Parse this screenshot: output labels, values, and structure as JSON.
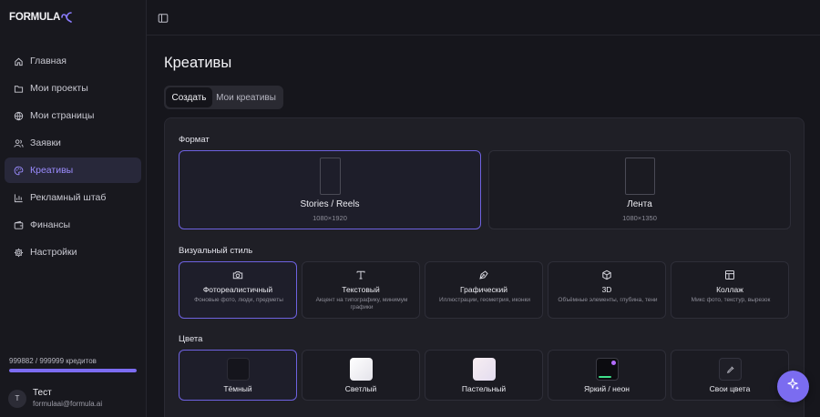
{
  "brand": {
    "name": "FORMULA",
    "accent": "#7c6cf2"
  },
  "sidebar": {
    "items": [
      {
        "label": "Главная",
        "icon": "home-icon"
      },
      {
        "label": "Мои проекты",
        "icon": "folder-icon"
      },
      {
        "label": "Мои страницы",
        "icon": "globe-icon"
      },
      {
        "label": "Заявки",
        "icon": "users-icon"
      },
      {
        "label": "Креативы",
        "icon": "palette-icon",
        "active": true
      },
      {
        "label": "Рекламный штаб",
        "icon": "bar-chart-icon"
      },
      {
        "label": "Финансы",
        "icon": "wallet-icon"
      },
      {
        "label": "Настройки",
        "icon": "gear-icon"
      }
    ],
    "credits_text": "999882 / 999999 кредитов",
    "credits_fraction": 0.9999,
    "user": {
      "initial": "Т",
      "name": "Тест",
      "email": "formulaai@formula.ai"
    }
  },
  "header": {
    "toggle_icon": "sidebar-toggle-icon"
  },
  "page": {
    "title": "Креативы",
    "tabs": [
      {
        "label": "Создать",
        "active": true
      },
      {
        "label": "Мои креативы",
        "active": false
      }
    ]
  },
  "format": {
    "label": "Формат",
    "options": [
      {
        "title": "Stories / Reels",
        "size": "1080×1920",
        "selected": true
      },
      {
        "title": "Лента",
        "size": "1080×1350",
        "selected": false
      }
    ]
  },
  "style": {
    "label": "Визуальный стиль",
    "options": [
      {
        "title": "Фотореалистичный",
        "desc": "Фоновые фото, люди, предметы",
        "icon": "camera-icon",
        "selected": true
      },
      {
        "title": "Текстовый",
        "desc": "Акцент на типографику, минимум графики",
        "icon": "text-icon"
      },
      {
        "title": "Графический",
        "desc": "Иллюстрации, геометрия, иконки",
        "icon": "pen-tool-icon"
      },
      {
        "title": "3D",
        "desc": "Объёмные элементы, глубина, тени",
        "icon": "cube-icon"
      },
      {
        "title": "Коллаж",
        "desc": "Микс фото, текстур, вырезок",
        "icon": "layout-icon"
      }
    ]
  },
  "colors": {
    "label": "Цвета",
    "options": [
      {
        "title": "Тёмный",
        "swatch": "#15151c",
        "selected": true
      },
      {
        "title": "Светлый",
        "swatch": "#f1f0f4"
      },
      {
        "title": "Пастельный",
        "swatch": "#ece4ee"
      },
      {
        "title": "Яркий / неон",
        "swatch": "#0c0c10"
      },
      {
        "title": "Свои цвета",
        "icon": "eyedropper-icon"
      }
    ]
  },
  "fab": {
    "icon": "sparkle-icon"
  }
}
